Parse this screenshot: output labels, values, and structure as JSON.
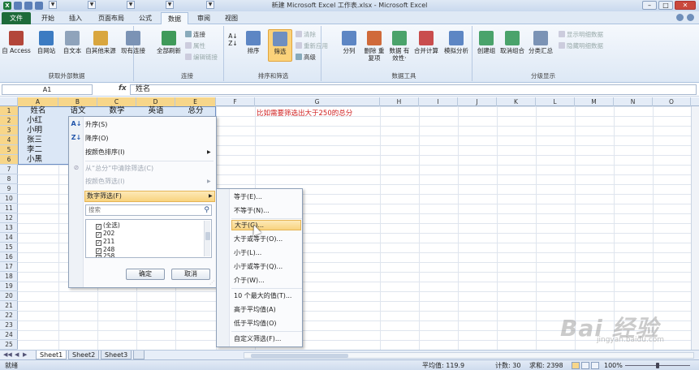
{
  "window": {
    "title": "新建 Microsoft Excel 工作表.xlsx - Microsoft Excel",
    "excel_logo": "X"
  },
  "tabs": [
    "文件",
    "开始",
    "插入",
    "页面布局",
    "公式",
    "数据",
    "审阅",
    "视图"
  ],
  "active_tab": "数据",
  "ribbon": {
    "groups": {
      "external": {
        "name": "获取外部数据",
        "buttons": [
          "自 Access",
          "自网站",
          "自文本",
          "自其他来源",
          "现有连接"
        ]
      },
      "connections": {
        "name": "连接",
        "refresh": "全部刷新",
        "items": [
          "连接",
          "属性",
          "编辑链接"
        ]
      },
      "sortfilter": {
        "name": "排序和筛选",
        "sort": "排序",
        "filter": "筛选",
        "items": [
          "清除",
          "重新应用",
          "高级"
        ]
      },
      "datatools": {
        "name": "数据工具",
        "buttons": [
          "分列",
          "删除\n重复项",
          "数据\n有效性·",
          "合并计算",
          "模拟分析"
        ]
      },
      "outline": {
        "name": "分级显示",
        "buttons": [
          "创建组",
          "取消组合",
          "分类汇总"
        ],
        "items": [
          "显示明细数据",
          "隐藏明细数据"
        ]
      }
    }
  },
  "formula_bar": {
    "name_box": "A1",
    "fx": "fx",
    "content": "姓名"
  },
  "columns": [
    "A",
    "B",
    "C",
    "D",
    "E",
    "F",
    "G",
    "H",
    "I",
    "J",
    "K",
    "L",
    "M",
    "N",
    "O"
  ],
  "rows": [
    "1",
    "2",
    "3",
    "4",
    "5",
    "6",
    "7",
    "8",
    "9",
    "10",
    "11",
    "12",
    "13",
    "14",
    "15",
    "16",
    "17",
    "18",
    "19",
    "20",
    "21",
    "22",
    "23",
    "24",
    "25"
  ],
  "sheet": {
    "headers": [
      "姓名",
      "语文",
      "数学",
      "英语",
      "总分"
    ],
    "names": [
      "小红",
      "小明",
      "张三",
      "李二",
      "小黑"
    ],
    "note": "比如需要筛选出大于250的总分"
  },
  "filter_menu": {
    "sort_asc": "升序(S)",
    "sort_desc": "降序(O)",
    "sort_color": "按颜色排序(I)",
    "clear": "从“总分”中清除筛选(C)",
    "color_filter": "按颜色筛选(I)",
    "number_filter": "数字筛选(F)",
    "search_placeholder": "搜索",
    "checklist": [
      "(全选)",
      "202",
      "211",
      "248",
      "258"
    ],
    "ok": "确定",
    "cancel": "取消"
  },
  "number_filter_submenu": [
    "等于(E)...",
    "不等于(N)...",
    "大于(G)...",
    "大于或等于(O)...",
    "小于(L)...",
    "小于或等于(Q)...",
    "介于(W)...",
    "10 个最大的值(T)...",
    "高于平均值(A)",
    "低于平均值(O)",
    "自定义筛选(F)..."
  ],
  "highlighted_submenu_item": "大于(G)...",
  "sheet_tabs": [
    "Sheet1",
    "Sheet2",
    "Sheet3"
  ],
  "status": {
    "ready": "就绪",
    "average": "平均值: 119.9",
    "count": "计数: 30",
    "sum": "求和: 2398",
    "zoom": "100%"
  },
  "watermark": {
    "brand": "Bai 经验",
    "url": "jingyan.baidu.com"
  },
  "colors": {
    "accent_file_tab": "#1e6b3a",
    "selection_fill": "#dbe7f6",
    "highlight": "#f8d37f",
    "note_red": "#d02020"
  }
}
